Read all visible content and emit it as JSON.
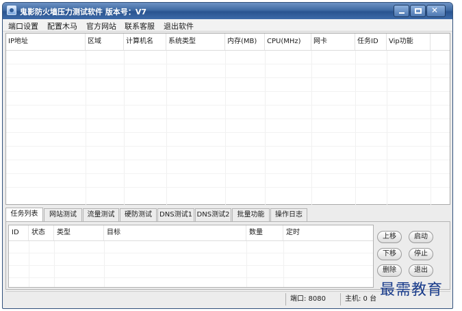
{
  "window": {
    "title": "鬼影防火墙压力测试软件 版本号：V7",
    "close_glyph": "✕"
  },
  "menu": [
    "端口设置",
    "配置木马",
    "官方网站",
    "联系客服",
    "退出软件"
  ],
  "main_table": {
    "columns": [
      "IP地址",
      "区域",
      "计算机名",
      "系统类型",
      "内存(MB)",
      "CPU(MHz)",
      "网卡",
      "任务ID",
      "Vip功能"
    ]
  },
  "tabs": {
    "items": [
      "任务列表",
      "网站测试",
      "流量测试",
      "硬防测试",
      "DNS测试1",
      "DNS测试2",
      "批量功能",
      "操作日志"
    ],
    "active_index": 0
  },
  "task_table": {
    "columns": [
      "ID",
      "状态",
      "类型",
      "目标",
      "数量",
      "定时"
    ]
  },
  "buttons": {
    "move_up": "上移",
    "start": "启动",
    "move_down": "下移",
    "stop": "停止",
    "delete": "删除",
    "exit": "退出"
  },
  "status": {
    "port": "端口: 8080",
    "hosts": "主机: 0 台"
  },
  "watermark": "最需教育"
}
